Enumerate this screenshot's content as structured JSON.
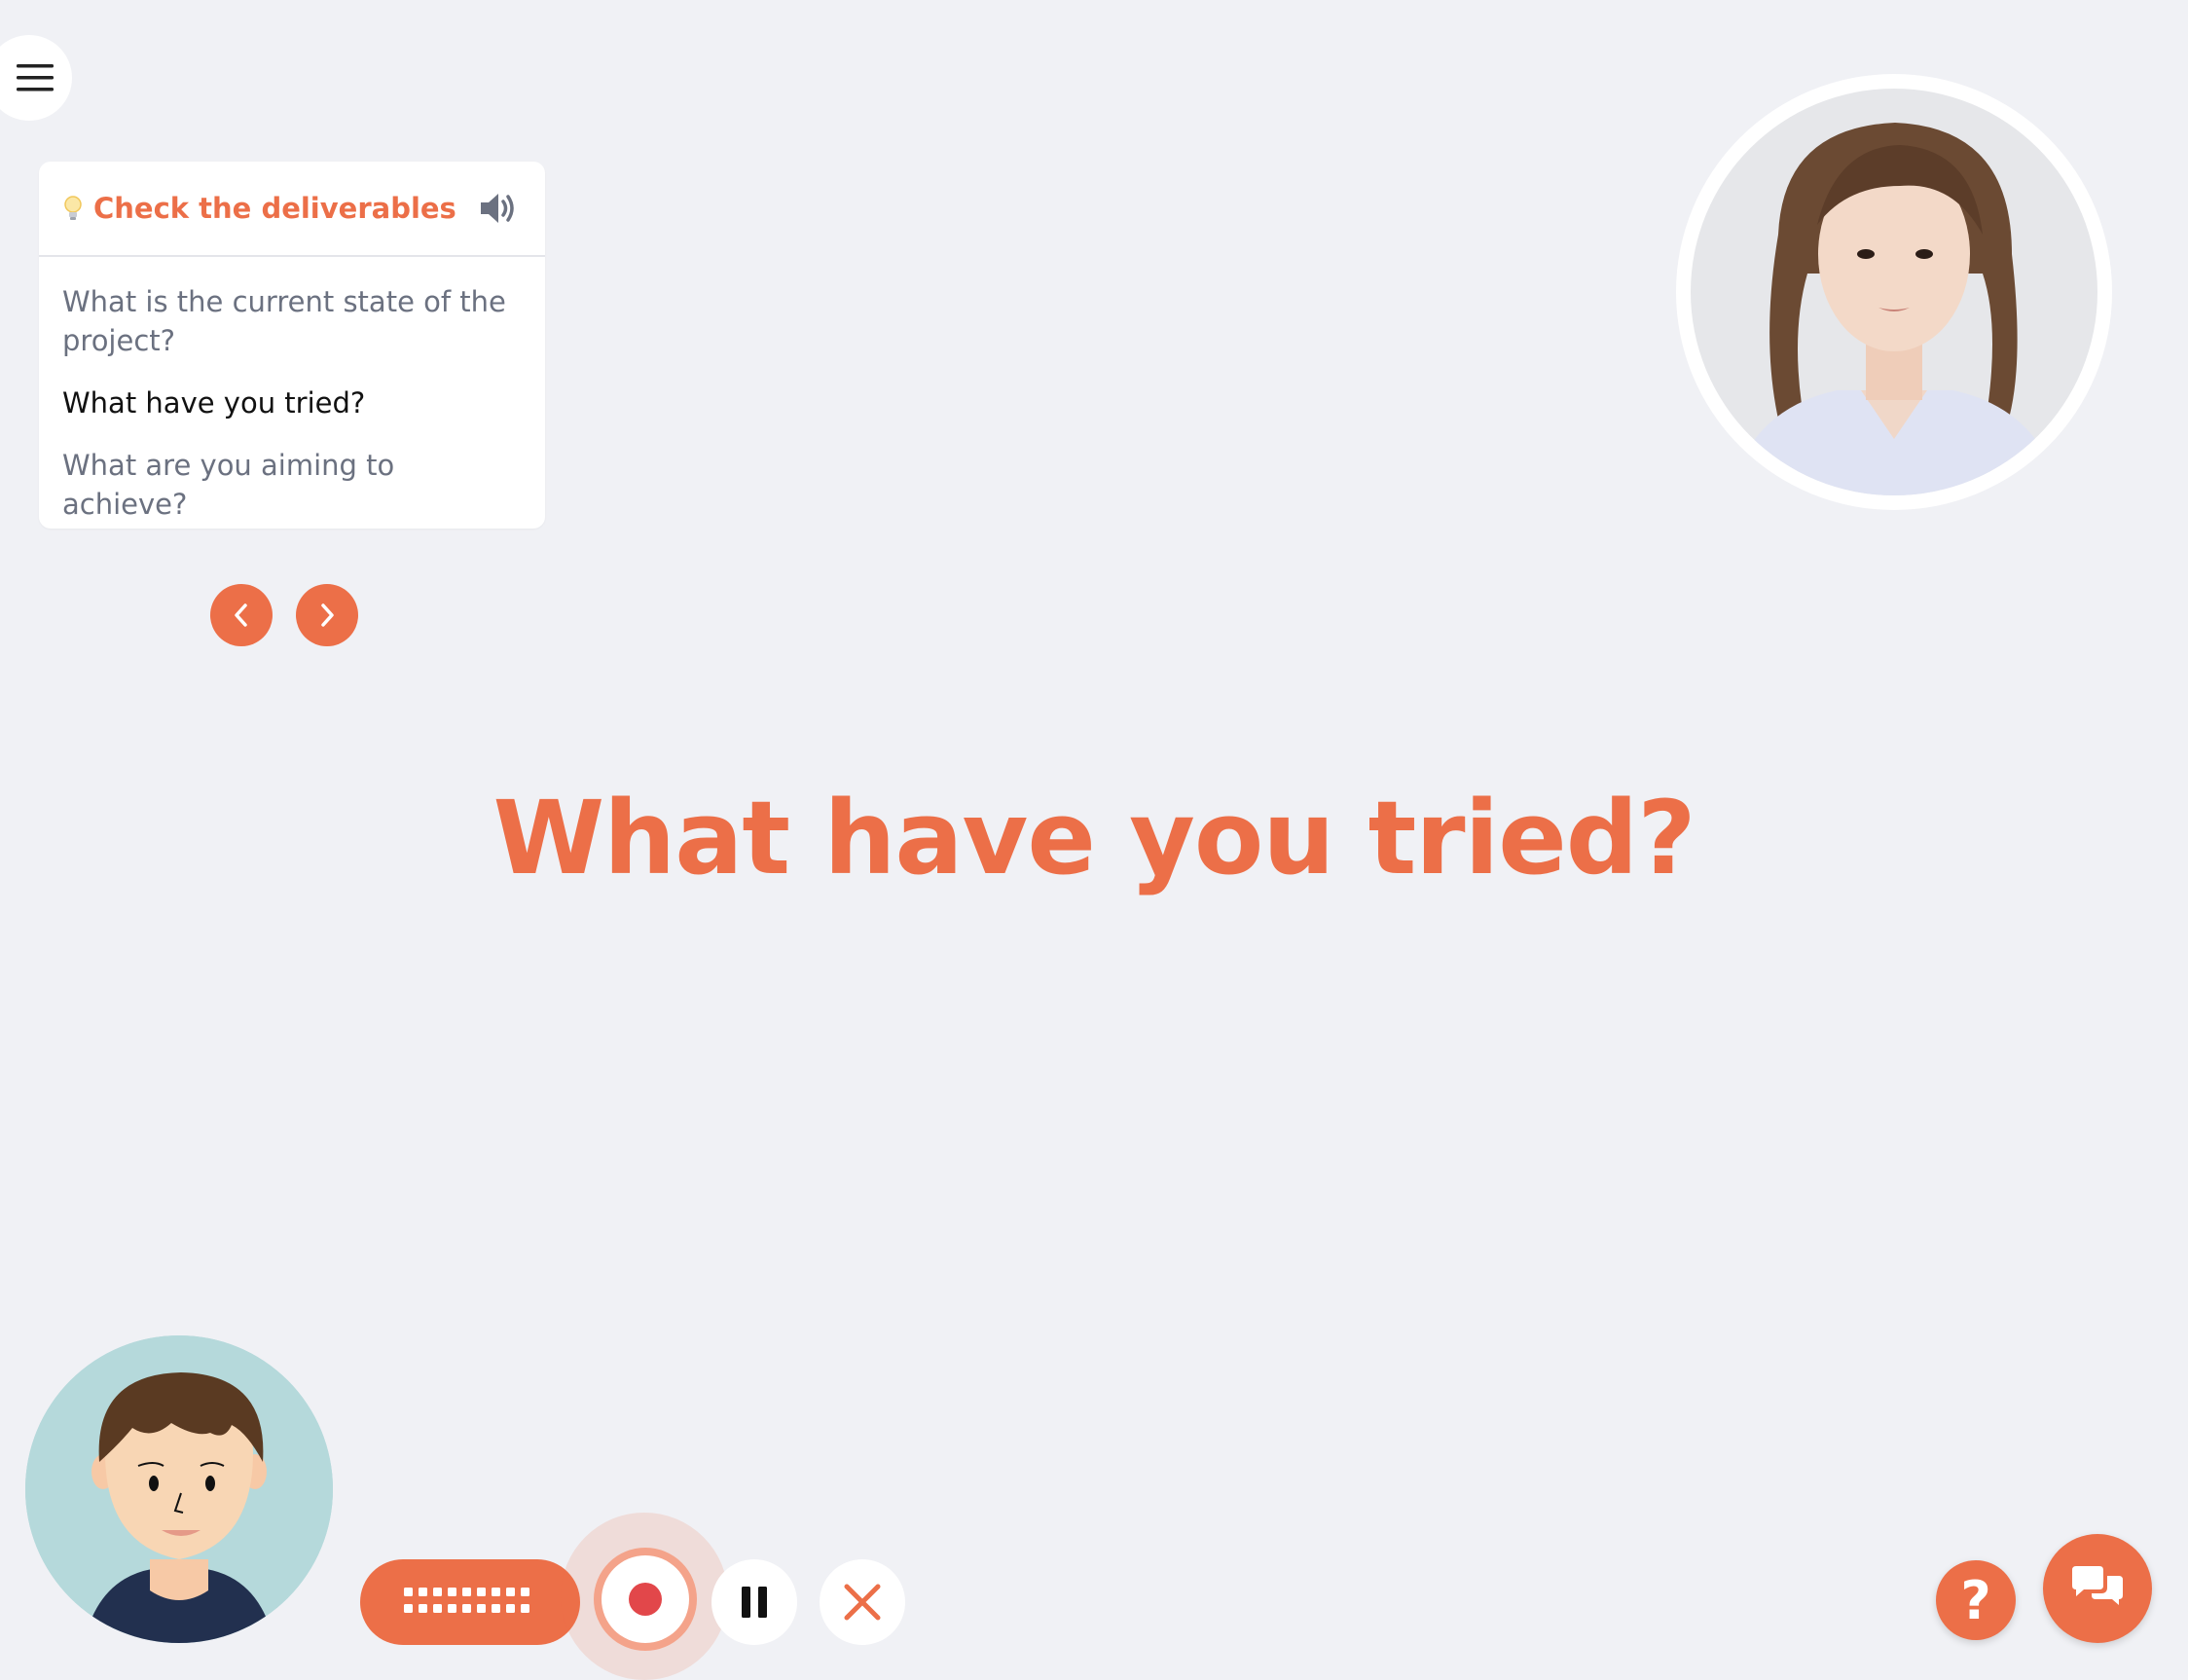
{
  "hint_card": {
    "title": "Check the deliverables",
    "items": [
      "What is the current state of the project?",
      "What have you tried?",
      "What are you aiming to achieve?"
    ],
    "active_index": 1
  },
  "question": "What have you tried?",
  "help": {
    "label": "?"
  },
  "icons": {
    "menu": "hamburger-menu-icon",
    "hint": "lightbulb-icon",
    "speaker": "speaker-volume-icon",
    "prev": "chevron-left-icon",
    "next": "chevron-right-icon",
    "keyboard": "keyboard-icon",
    "record": "record-icon",
    "pause": "pause-icon",
    "close": "close-icon",
    "chat": "chat-bubbles-icon"
  },
  "colors": {
    "accent": "#ec6f48",
    "background": "#f0f1f5",
    "record": "#e2474a",
    "muted_text": "#6b7180"
  }
}
